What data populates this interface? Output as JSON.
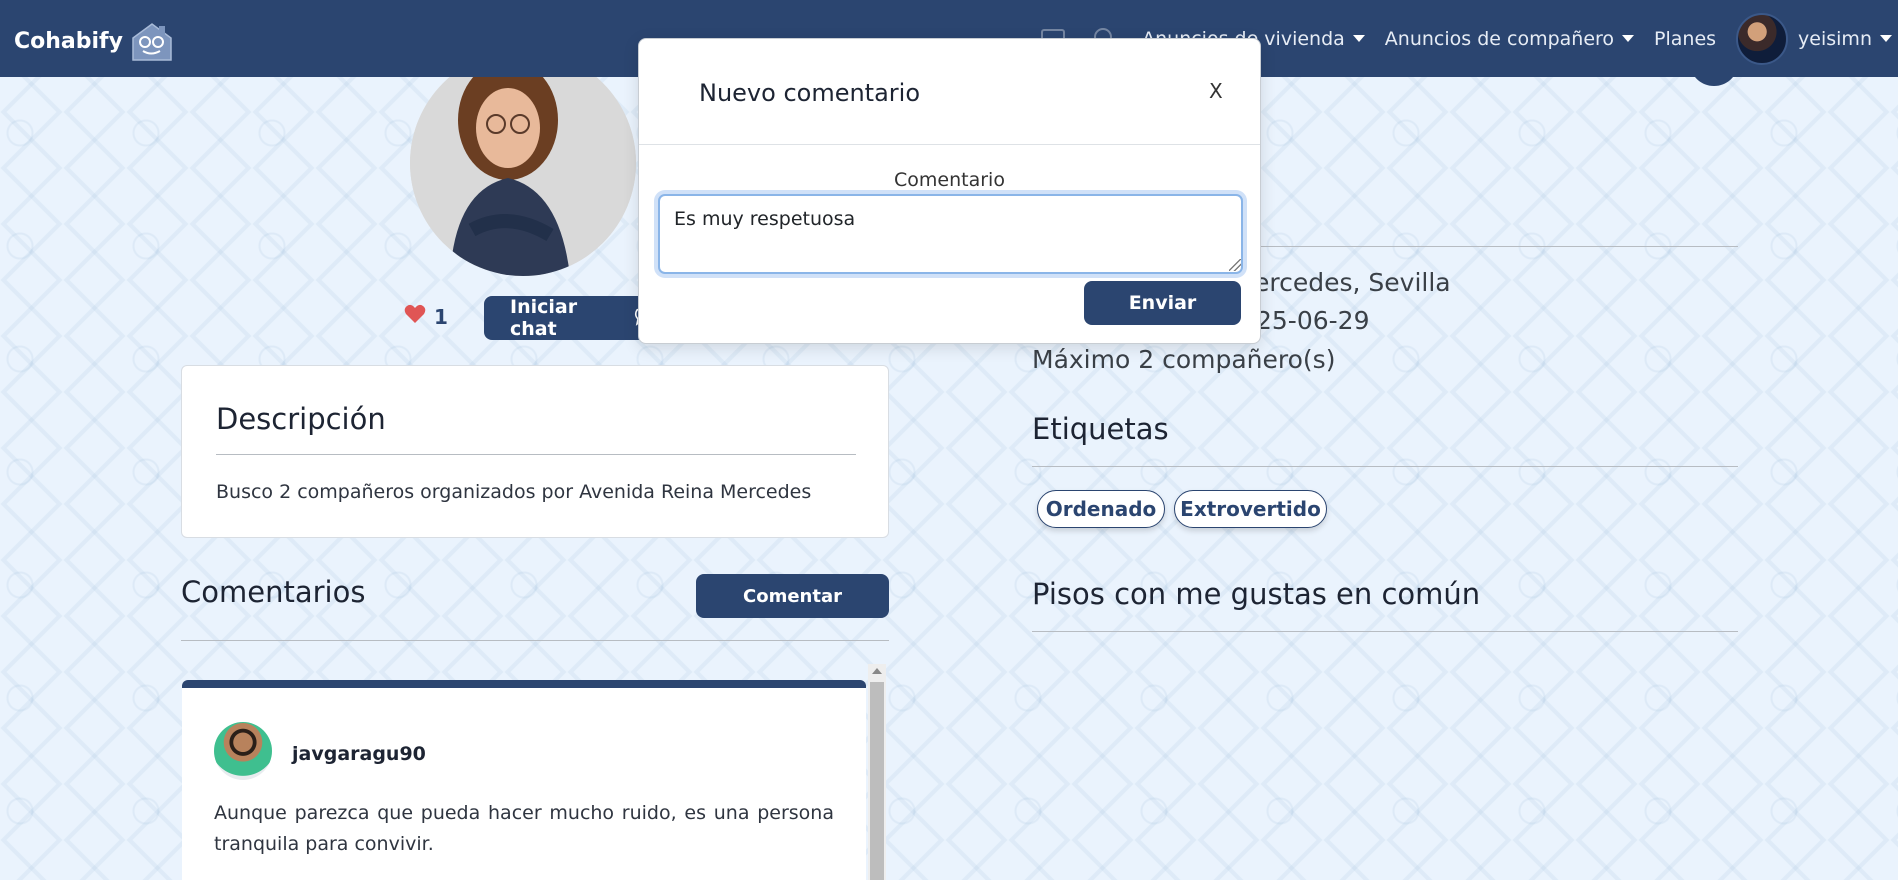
{
  "navbar": {
    "brand": "Cohabify",
    "links": [
      {
        "label": "Anuncios de vivienda",
        "has_caret": true
      },
      {
        "label": "Anuncios de compañero",
        "has_caret": true
      },
      {
        "label": "Planes",
        "has_caret": false
      }
    ],
    "username": "yeisimn",
    "colors": {
      "background": "#2b4570",
      "text": "#ffffff"
    }
  },
  "profile": {
    "likes": "1",
    "chat_button": "Iniciar chat",
    "description_title": "Descripción",
    "description_text": "Busco 2 compañeros organizados por Avenida Reina Mercedes"
  },
  "comments": {
    "title": "Comentarios",
    "add_button": "Comentar",
    "items": [
      {
        "user": "javgaragu90",
        "text": "Aunque parezca que pueda hacer mucho ruido, es una persona tranquila para convivir."
      }
    ]
  },
  "details": {
    "location": "ercedes, Sevilla",
    "date": "25-06-29",
    "max_companions": "Máximo 2 compañero(s)",
    "tags_title": "Etiquetas",
    "tags": [
      "Ordenado",
      "Extrovertido"
    ],
    "shared_likes_title": "Pisos con me gustas en común"
  },
  "modal": {
    "title": "Nuevo comentario",
    "close_label": "X",
    "field_label": "Comentario",
    "textarea_value": "Es muy respetuosa",
    "submit_label": "Enviar"
  },
  "icons": {
    "brand_logo": "house-face-icon",
    "heart": "heart-icon",
    "chat": "chat-bubble-icon"
  },
  "accent_color": "#2b4570",
  "like_color": "#e05555"
}
